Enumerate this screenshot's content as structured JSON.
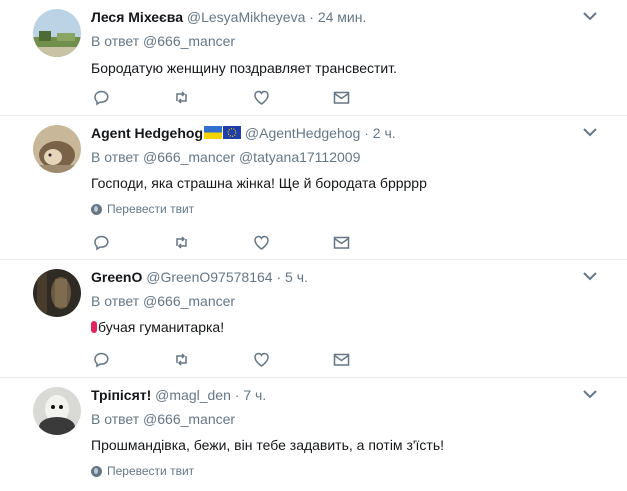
{
  "tweets": [
    {
      "name": "Леся Міхеєва",
      "handle": "@LesyaMikheyeva",
      "sep": "·",
      "time": "24 мин.",
      "reply_prefix": "В ответ",
      "mentions": "@666_mancer",
      "text": "Бородатую женщину поздравляет трансвестит.",
      "translate": ""
    },
    {
      "name": "Agent Hedgehog",
      "handle": "@AgentHedgehog",
      "sep": "·",
      "time": "2 ч.",
      "reply_prefix": "В ответ",
      "mentions": "@666_mancer",
      "mentions2": "@tatyana17112009",
      "text": "Господи, яка страшна жінка! Ще й бородата бррррр",
      "translate": "Перевести твит"
    },
    {
      "name": "GreenO",
      "handle": "@GreenO97578164",
      "sep": "·",
      "time": "5 ч.",
      "reply_prefix": "В ответ",
      "mentions": "@666_mancer",
      "text": "бучая гуманитарка!",
      "translate": ""
    },
    {
      "name": "Тріпісят!",
      "handle": "@magl_den",
      "sep": "·",
      "time": "7 ч.",
      "reply_prefix": "В ответ",
      "mentions": "@666_mancer",
      "text": "Прошмандівка, бежи, він тебе задавить, а потім з'їсть!",
      "translate": "Перевести твит"
    }
  ],
  "icons": {
    "reply": "reply-icon",
    "retweet": "retweet-icon",
    "like": "heart-icon",
    "dm": "envelope-icon",
    "more": "chevron-down-icon",
    "translate": "globe-icon"
  },
  "colors": {
    "icon_gray": "#657786",
    "divider": "#e6ecf0",
    "mark_red": "#e0245e"
  }
}
